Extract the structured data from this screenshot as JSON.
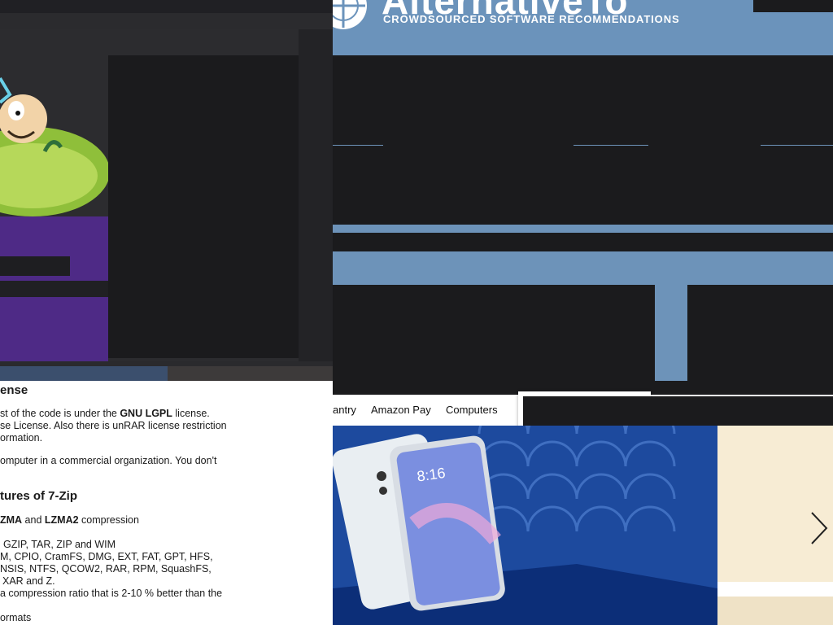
{
  "site": {
    "brand_name": "AlternativeTo",
    "tagline": "CROWDSOURCED SOFTWARE RECOMMENDATIONS"
  },
  "shop_nav": {
    "items": [
      "antry",
      "Amazon Pay",
      "Computers"
    ]
  },
  "banner": {
    "phone_time": "8:16"
  },
  "info_panel": {
    "license_heading": "ense",
    "license_lines": [
      {
        "pre": "st of the code is under the ",
        "bold": "GNU LGPL",
        "post": " license."
      },
      {
        "pre": "se License. Also there is unRAR license restriction",
        "bold": "",
        "post": ""
      },
      {
        "pre": "ormation.",
        "bold": "",
        "post": ""
      },
      {
        "pre": "omputer in a commercial organization. You don't",
        "bold": "",
        "post": ""
      }
    ],
    "features_heading": "tures of 7-Zip",
    "feature_lzma": {
      "b1": "ZMA",
      "mid": " and ",
      "b2": "LZMA2",
      "post": " compression"
    },
    "feature_lines": [
      "GZIP, TAR, ZIP and WIM",
      "M, CPIO, CramFS, DMG, EXT, FAT, GPT, HFS,",
      "NSIS, NTFS, QCOW2, RAR, RPM, SquashFS,",
      "XAR and Z.",
      "a compression ratio that is 2-10 % better than the",
      "ormats"
    ]
  },
  "icons": {
    "logo": "compass-globe-icon",
    "slider_next": "chevron-right-icon"
  },
  "colors": {
    "header_blue": "#6b93bb",
    "overlay_dark": "#1b1b1d",
    "banner_blue": "#1d4a9e",
    "left_purple": "#4e2a86"
  }
}
